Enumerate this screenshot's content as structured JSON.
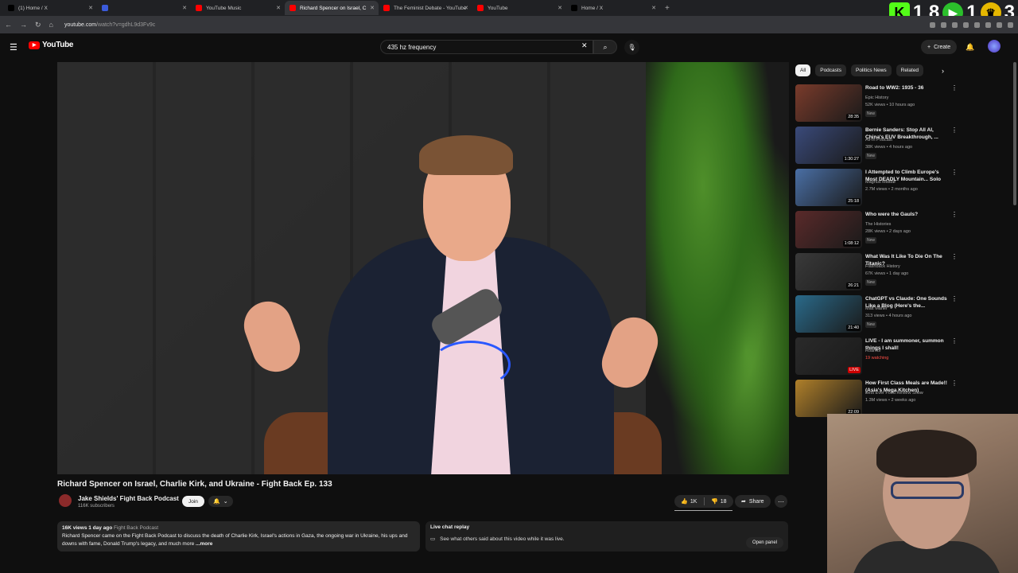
{
  "browser": {
    "tabs": [
      {
        "label": "(1) Home / X",
        "icon": "x-icon",
        "color": "#000000"
      },
      {
        "label": "",
        "icon": "mail-icon",
        "color": "#3b5bdb"
      },
      {
        "label": "YouTube Music",
        "icon": "youtube-music-icon",
        "color": "#ff0000"
      },
      {
        "label": "Richard Spencer on Israel, C",
        "icon": "youtube-icon",
        "color": "#ff0000",
        "active": true
      },
      {
        "label": "The Feminist Debate - YouTube",
        "icon": "youtube-icon",
        "color": "#ff0000"
      },
      {
        "label": "YouTube",
        "icon": "youtube-icon",
        "color": "#ff0000"
      },
      {
        "label": "Home / X",
        "icon": "x-icon",
        "color": "#000000"
      }
    ],
    "newtab": "+",
    "url_host": "youtube.com",
    "url_path": "/watch?v=gdhL9d3Fv9c"
  },
  "overlay": {
    "kick_count": "1 8",
    "rumble_count": "1",
    "other_count": "3"
  },
  "youtube": {
    "logo": "YouTube",
    "search_value": "435 hz frequency",
    "create_label": "Create"
  },
  "video": {
    "title": "Richard Spencer on Israel, Charlie Kirk, and Ukraine - Fight Back Ep. 133",
    "channel": "Jake Shields' Fight Back Podcast",
    "subscribers": "116K subscribers",
    "join_label": "Join",
    "likes": "1K",
    "dislikes": "18",
    "like_ratio": 0.98,
    "share_label": "Share",
    "views_meta": "16K views  1 day ago",
    "tag": "Fight Back Podcast",
    "description": "Richard Spencer came on the Fight Back Podcast to discuss the death of Charlie Kirk, Israel's actions in Gaza, the ongoing war in Ukraine, his ups and downs with fame, Donald Trump's legacy, and much more",
    "more_label": "...more",
    "chat_title": "Live chat replay",
    "chat_text": "See what others said about this video while it was live.",
    "open_panel": "Open panel"
  },
  "chips": [
    "All",
    "Podcasts",
    "Politics News",
    "Related"
  ],
  "recommendations": [
    {
      "title": "Road to WW2: 1935 - 36",
      "channel": "Epic History",
      "meta": "52K views • 10 hours ago",
      "new": "New",
      "duration": "28:35",
      "color": "#7a3b2b"
    },
    {
      "title": "Bernie Sanders: Stop All AI, China's EUV Breakthrough, ...",
      "channel": "All-In Podcast",
      "meta": "38K views • 4 hours ago",
      "new": "New",
      "duration": "1:30:27",
      "color": "#3a4a7a"
    },
    {
      "title": "I Attempted to Climb Europe's Most DEADLY Mountain... Solo",
      "channel": "Magnus Midtbø",
      "meta": "2.7M views • 2 months ago",
      "new": "",
      "duration": "25:18",
      "color": "#4a6fa5"
    },
    {
      "title": "Who were the Gauls?",
      "channel": "The Histories",
      "meta": "28K views • 2 days ago",
      "new": "New",
      "duration": "1:08:12",
      "color": "#5a2a2a"
    },
    {
      "title": "What Was It Like To Die On The Titanic?",
      "channel": "Flashback History",
      "meta": "67K views • 1 day ago",
      "new": "New",
      "duration": "26:21",
      "color": "#3a3a3a"
    },
    {
      "title": "ChatGPT vs Claude: One Sounds Like a Blog (Here's the...",
      "channel": "Matt Maher",
      "meta": "313 views • 4 hours ago",
      "new": "New",
      "duration": "21:40",
      "color": "#2a6a8a"
    },
    {
      "title": "LIVE - I am summoner, summon things I shall!",
      "channel": "Roarrior",
      "meta": "19 watching",
      "new": "",
      "duration": "LIVE",
      "color": "#2a2a2a",
      "live": true
    },
    {
      "title": "How First Class Meals are Made!! (Asia's Mega Kitchen)",
      "channel": "Best Ever Food Review Show",
      "meta": "1.3M views • 2 weeks ago",
      "new": "",
      "duration": "22:09",
      "color": "#b0802a"
    }
  ]
}
